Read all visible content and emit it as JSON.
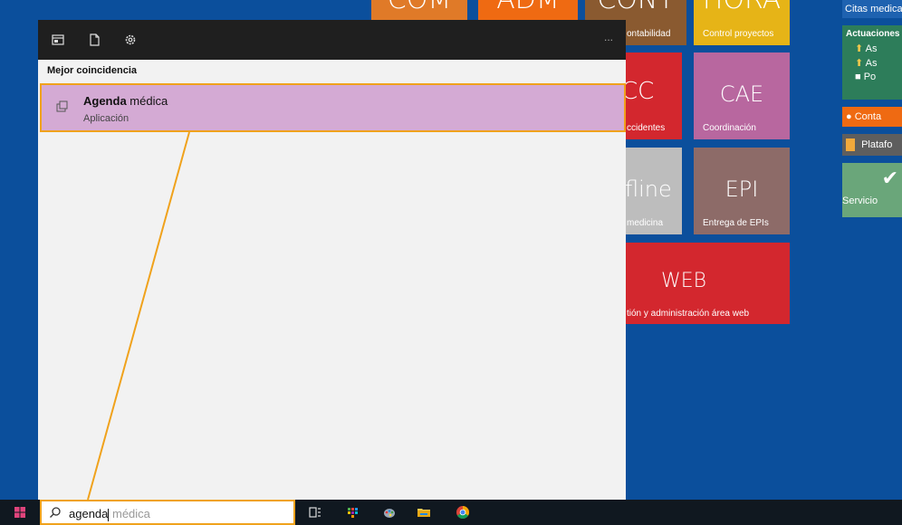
{
  "tiles": {
    "row1": [
      {
        "label": "COM",
        "color": "#e07a28"
      },
      {
        "label": "ADM",
        "color": "#ef6a12"
      },
      {
        "label": "CONT",
        "sub": "ontabilidad",
        "color": "#8a5a30"
      },
      {
        "label": "HORA",
        "sub": "Control proyectos",
        "color": "#e6b417"
      }
    ],
    "acc": {
      "label": "CC",
      "sub": "ccidentes",
      "color": "#d3272e"
    },
    "cae": {
      "label": "CAE",
      "sub": "Coordinación",
      "color": "#b8679f"
    },
    "offline": {
      "label": "fline",
      "sub": "medicina",
      "color": "#bdbdbd"
    },
    "epi": {
      "label": "EPI",
      "sub": "Entrega de EPIs",
      "color": "#8d6b68"
    },
    "web": {
      "label": "WEB",
      "sub": "tión y administración área web",
      "color": "#d3272e"
    }
  },
  "right_panel": {
    "citas": "Citas medica",
    "actuaciones_title": "Actuaciones",
    "actuaciones_items": [
      "As",
      "As",
      "Po"
    ],
    "contacto": "Conta",
    "plataforma": "Platafo",
    "servicios": "Servicio"
  },
  "flyout": {
    "more": "...",
    "section_title": "Mejor coincidencia",
    "result": {
      "title_bold": "Agenda",
      "title_rest": " médica",
      "subtitle": "Aplicación"
    }
  },
  "taskbar": {
    "search_typed": "agenda",
    "search_suggest": " médica"
  },
  "colors": {
    "desktop": "#0b4f9c",
    "highlight": "#f0a21c",
    "selected_result": "#d4aad4"
  }
}
